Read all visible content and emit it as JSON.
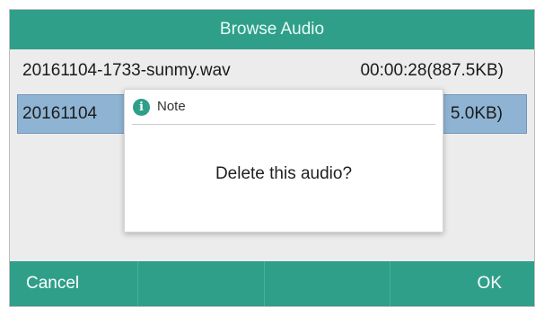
{
  "title": "Browse Audio",
  "list": [
    {
      "name": "20161104-1733-sunmy.wav",
      "meta": "00:00:28(887.5KB)"
    },
    {
      "name": "20161104",
      "meta": "5.0KB)"
    }
  ],
  "dialog": {
    "icon": "info-icon",
    "title": "Note",
    "message": "Delete this audio?"
  },
  "softkeys": {
    "left": "Cancel",
    "k2": "",
    "k3": "",
    "right": "OK"
  },
  "colors": {
    "accent": "#2f9f89",
    "selection": "#8fb4d3",
    "background": "#ececec"
  }
}
